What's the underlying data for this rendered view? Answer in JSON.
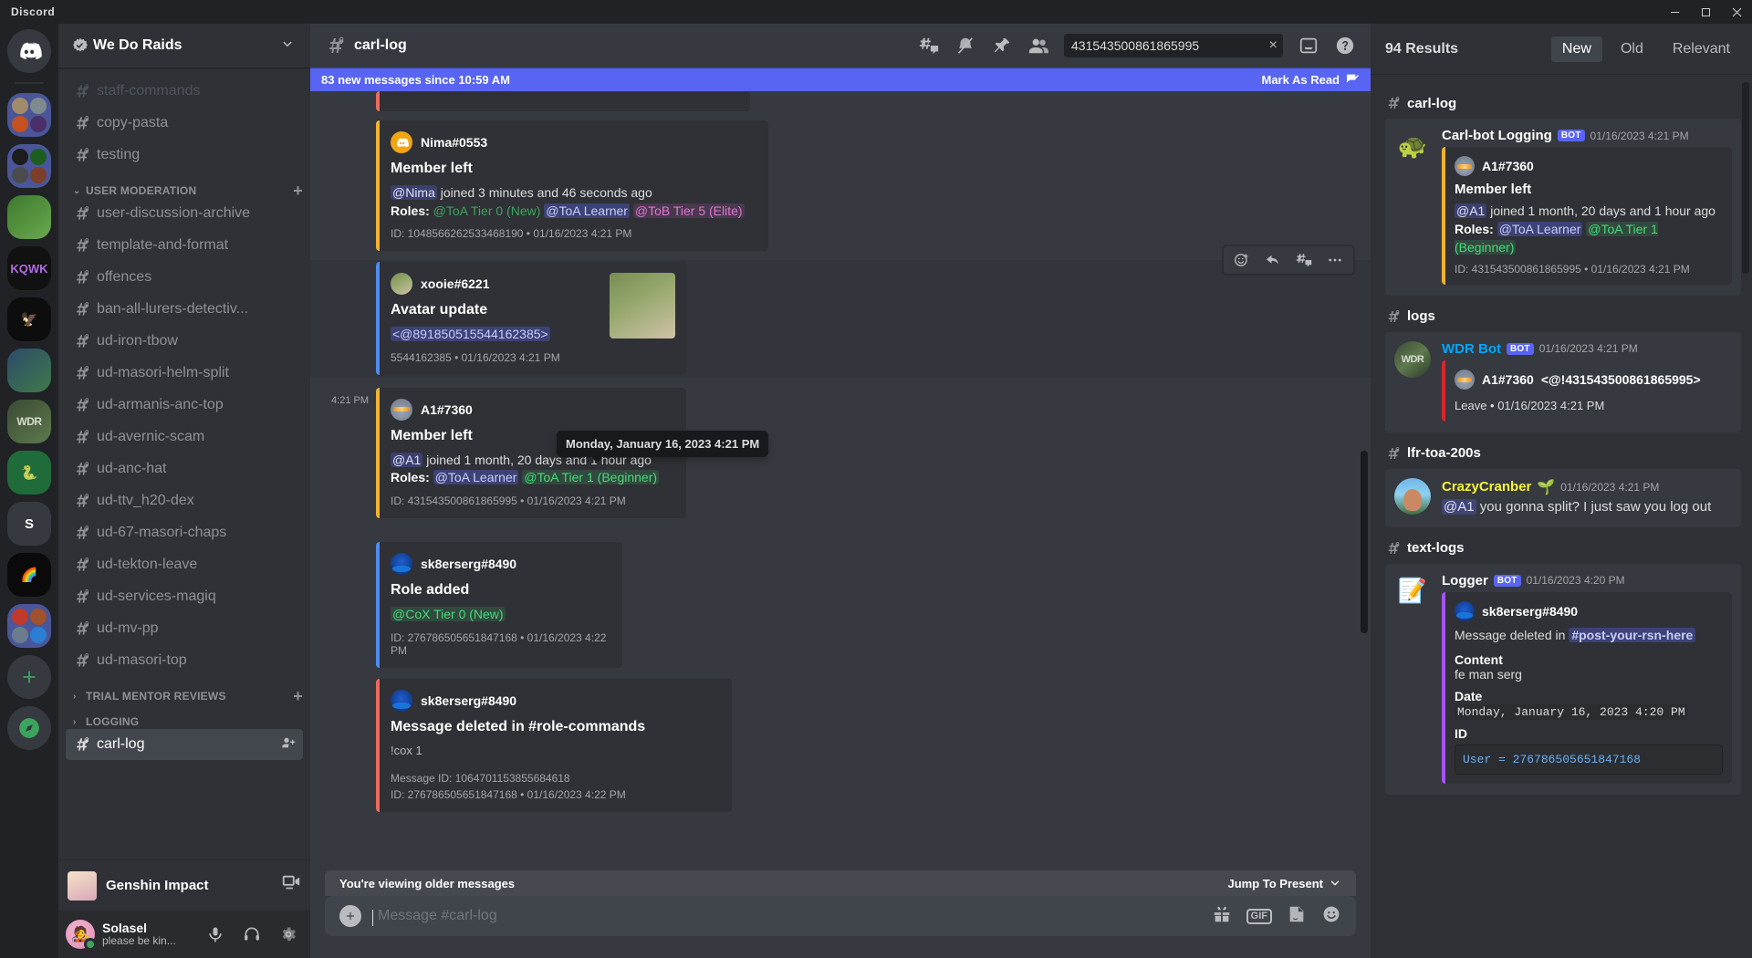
{
  "titlebar": {
    "app_name": "Discord"
  },
  "rail": {
    "home_label": "Home",
    "items": [
      {
        "name": "guild-home",
        "label": "Discord"
      },
      {
        "name": "guild-folder-1",
        "label": "Folder"
      },
      {
        "name": "guild-folder-2",
        "label": "Folder"
      },
      {
        "name": "guild-green",
        "label": "Server"
      },
      {
        "name": "guild-kqwk",
        "label": "KQWK"
      },
      {
        "name": "guild-yellow-bird",
        "label": "Server"
      },
      {
        "name": "guild-earth",
        "label": "Server"
      },
      {
        "name": "guild-wdr",
        "label": "WDR",
        "active": true
      },
      {
        "name": "guild-snake",
        "label": "Server"
      },
      {
        "name": "guild-s",
        "label": "S"
      },
      {
        "name": "guild-rainbow",
        "label": "Server"
      },
      {
        "name": "guild-folder-3",
        "label": "Folder"
      },
      {
        "name": "guild-add",
        "label": "Add a Server"
      },
      {
        "name": "guild-explore",
        "label": "Explore Public Servers"
      }
    ]
  },
  "sidebar": {
    "guild_name": "We Do Raids",
    "channels": [
      {
        "name": "staff-commands",
        "state": "muted",
        "locked": true
      },
      {
        "name": "copy-pasta",
        "state": "normal",
        "locked": true
      },
      {
        "name": "testing",
        "state": "normal",
        "locked": true
      }
    ],
    "categories": [
      {
        "label": "USER MODERATION",
        "expanded": true,
        "has_add": true,
        "channels": [
          {
            "name": "user-discussion-archive",
            "locked": true
          },
          {
            "name": "template-and-format",
            "locked": true
          },
          {
            "name": "offences",
            "locked": true
          },
          {
            "name": "ban-all-lurers-detectiv...",
            "locked": true
          },
          {
            "name": "ud-iron-tbow",
            "locked": true
          },
          {
            "name": "ud-masori-helm-split",
            "locked": true
          },
          {
            "name": "ud-armanis-anc-top",
            "locked": true
          },
          {
            "name": "ud-avernic-scam",
            "locked": true
          },
          {
            "name": "ud-anc-hat",
            "locked": true
          },
          {
            "name": "ud-ttv_h20-dex",
            "locked": true
          },
          {
            "name": "ud-67-masori-chaps",
            "locked": true
          },
          {
            "name": "ud-tekton-leave",
            "locked": true
          },
          {
            "name": "ud-services-magiq",
            "locked": true
          },
          {
            "name": "ud-mv-pp",
            "locked": true
          },
          {
            "name": "ud-masori-top",
            "locked": true
          }
        ]
      },
      {
        "label": "TRIAL MENTOR REVIEWS",
        "expanded": false,
        "has_add": true,
        "channels": []
      },
      {
        "label": "LOGGING",
        "expanded": false,
        "has_add": false,
        "channels": [
          {
            "name": "carl-log",
            "locked": true,
            "active": true,
            "action_icon": "add-member-icon"
          }
        ]
      }
    ],
    "activity": {
      "title": "Genshin Impact",
      "icon": "screen-share-icon"
    },
    "user": {
      "name": "Solasel",
      "status": "please be kin...",
      "presence": "online",
      "buttons": [
        "mic-icon",
        "headphones-icon",
        "gear-icon"
      ]
    }
  },
  "channel_header": {
    "channel": "carl-log",
    "icons": [
      "create-thread-icon",
      "notification-off-icon",
      "pinned-messages-icon",
      "member-list-icon",
      "inbox-icon",
      "help-icon"
    ]
  },
  "search": {
    "value": "431543500861865995",
    "placeholder": "Search",
    "clear_label": "×"
  },
  "new_messages_bar": {
    "text": "83 new messages since 10:59 AM",
    "mark_as_read": "Mark As Read"
  },
  "tooltip": {
    "text": "Monday, January 16, 2023 4:21 PM"
  },
  "messages": [
    {
      "id": "msg-nima",
      "accent": "#f0b232",
      "author": "Nima#0553",
      "avatar": "discord-default-avatar",
      "title": "Member left",
      "mention": "@Nima",
      "desc_rest": " joined 3 minutes and 46 seconds ago",
      "roles_label": "Roles:",
      "roles": [
        {
          "text": "@ToA Tier 0 (New)",
          "style": "green"
        },
        {
          "text": "@ToA Learner",
          "style": "blurple"
        },
        {
          "text": "@ToB Tier 5 (Elite)",
          "style": "pink"
        }
      ],
      "footer": "ID: 1048566262533468190 • 01/16/2023 4:21 PM"
    },
    {
      "id": "msg-xooie",
      "accent": "#4f8bf0",
      "author": "xooie#6221",
      "avatar": "xooie-avatar",
      "title": "Avatar update",
      "code_mention": "<@891850515544162385>",
      "footer": "5544162385 • 01/16/2023 4:21 PM",
      "thumbnail": "avatar-thumbnail",
      "hovered": true,
      "hover_tools": [
        "add-reaction-icon",
        "reply-icon",
        "create-thread-icon",
        "more-icon"
      ]
    },
    {
      "id": "msg-a1",
      "accent": "#f0b232",
      "gutter_ts": "4:21 PM",
      "author": "A1#7360",
      "avatar": "a1-avatar",
      "title": "Member left",
      "mention": "@A1",
      "desc_rest": " joined 1 month, 20 days and 1 hour ago",
      "roles_label": "Roles:",
      "roles": [
        {
          "text": "@ToA Learner",
          "style": "blurple"
        },
        {
          "text": "@ToA Tier 1 (Beginner)",
          "style": "greenonly"
        }
      ],
      "footer": "ID: 431543500861865995 • 01/16/2023 4:21 PM"
    },
    {
      "id": "msg-roleadd",
      "accent": "#4f8bf0",
      "author": "sk8erserg#8490",
      "avatar": "sk8-avatar",
      "title": "Role added",
      "role_single": "@CoX Tier 0 (New)",
      "footer": "ID: 276786505651847168 • 01/16/2023 4:22 PM"
    },
    {
      "id": "msg-deleted",
      "accent": "#ec6b5e",
      "author": "sk8erserg#8490",
      "avatar": "sk8-avatar",
      "title": "Message deleted in #role-commands",
      "content": "!cox 1",
      "message_id": "Message ID: 1064701153855684618",
      "footer": "ID: 276786505651847168 • 01/16/2023 4:22 PM"
    }
  ],
  "older_bar": {
    "text": "You're viewing older messages",
    "jump": "Jump To Present"
  },
  "composer": {
    "placeholder": "Message #carl-log",
    "tools": [
      "gift-icon",
      "gif-icon",
      "sticker-icon",
      "emoji-icon"
    ],
    "gif_label": "GIF"
  },
  "results_panel": {
    "count_label": "94 Results",
    "tabs": [
      {
        "label": "New",
        "active": true
      },
      {
        "label": "Old",
        "active": false
      },
      {
        "label": "Relevant",
        "active": false
      }
    ],
    "groups": [
      {
        "channel": "carl-log",
        "result": {
          "author": "Carl-bot Logging",
          "author_color": "white",
          "bot_tag": "BOT",
          "timestamp": "01/16/2023 4:21 PM",
          "avatar": "turtle-avatar",
          "embed": {
            "accent": "yellow",
            "embed_author": "A1#7360",
            "title": "Member left",
            "mention": "@A1",
            "desc_rest": " joined 1 month, 20 days and 1 hour ago",
            "roles_label": "Roles:",
            "roles": [
              {
                "text": "@ToA Learner",
                "style": "blurple"
              },
              {
                "text": "@ToA Tier 1 (Beginner)",
                "style": "greenonly"
              }
            ],
            "footer": "ID: 431543500861865995 • 01/16/2023 4:21 PM"
          }
        }
      },
      {
        "channel": "logs",
        "result": {
          "author": "WDR Bot",
          "author_color": "blue",
          "bot_tag": "BOT",
          "timestamp": "01/16/2023 4:21 PM",
          "avatar": "wdr-avatar",
          "embed": {
            "accent": "red",
            "embed_author": "A1#7360",
            "embed_author_mention": "<@!431543500861865995>",
            "footer": "Leave • 01/16/2023 4:21 PM"
          }
        }
      },
      {
        "channel": "lfr-toa-200s",
        "result": {
          "author": "CrazyCranber",
          "author_color": "yellow",
          "author_emoji": "🌱",
          "timestamp": "01/16/2023 4:21 PM",
          "avatar": "cranber-avatar",
          "text_mention": "@A1",
          "text_rest": " you gonna split? I just saw you log out"
        }
      },
      {
        "channel": "text-logs",
        "result": {
          "author": "Logger",
          "author_color": "white",
          "bot_tag": "BOT",
          "timestamp": "01/16/2023 4:20 PM",
          "avatar": "logger-avatar",
          "embed": {
            "accent": "purple",
            "embed_author": "sk8erserg#8490",
            "desc_prefix": "Message deleted in ",
            "channel_mention": "#post-your-rsn-here",
            "fields": [
              {
                "name": "Content",
                "value": "fe man serg"
              },
              {
                "name": "Date",
                "value": "Monday, January 16, 2023 4:20 PM",
                "code": true
              },
              {
                "name": "ID",
                "value": "User  = 276786505651847168",
                "block": true
              }
            ]
          }
        }
      }
    ]
  }
}
